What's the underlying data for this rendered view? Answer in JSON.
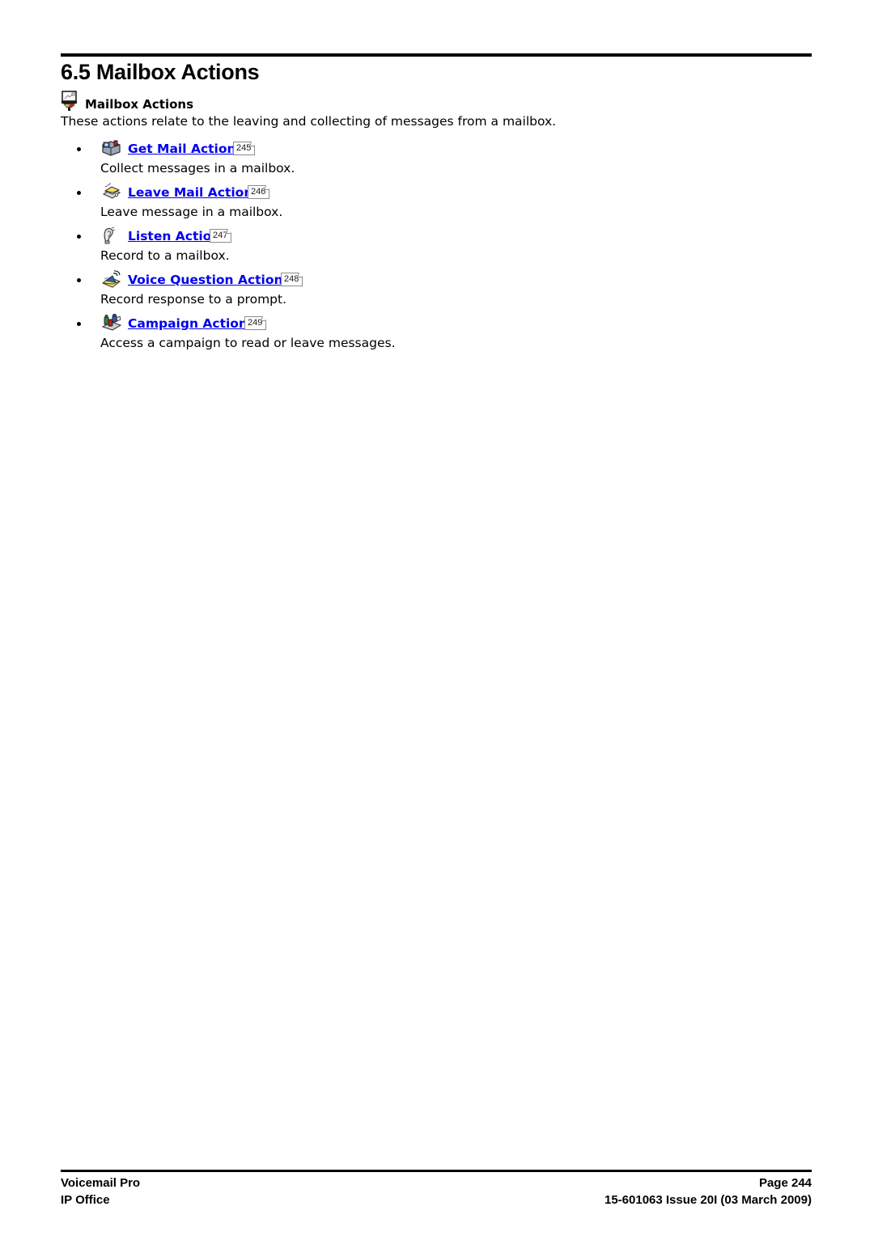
{
  "document": {
    "section_number_title": "6.5 Mailbox Actions",
    "subheading": {
      "icon": "mailbox-screen-icon",
      "label": "Mailbox Actions"
    },
    "intro_paragraph": "These actions relate to the leaving and collecting of messages from a mailbox."
  },
  "actions": [
    {
      "icon": "get-mail-icon",
      "link_label": "Get Mail Action",
      "page_ref": "245",
      "description": "Collect messages in a mailbox."
    },
    {
      "icon": "leave-mail-icon",
      "link_label": "Leave Mail Action",
      "page_ref": "246",
      "description": "Leave message in a mailbox."
    },
    {
      "icon": "listen-icon",
      "link_label": "Listen Action",
      "page_ref": "247",
      "description": "Record to a mailbox."
    },
    {
      "icon": "voice-question-icon",
      "link_label": "Voice Question Action",
      "page_ref": "248",
      "description": "Record response to a prompt."
    },
    {
      "icon": "campaign-icon",
      "link_label": "Campaign Action",
      "page_ref": "249",
      "description": "Access a campaign to read or leave messages."
    }
  ],
  "footer": {
    "left_line1": "Voicemail Pro",
    "left_line2": "IP Office",
    "right_line1": "Page 244",
    "right_line2": "15-601063 Issue 20I (03 March 2009)"
  },
  "colors": {
    "link": "#0000EE",
    "text": "#000000",
    "rule": "#000000"
  }
}
